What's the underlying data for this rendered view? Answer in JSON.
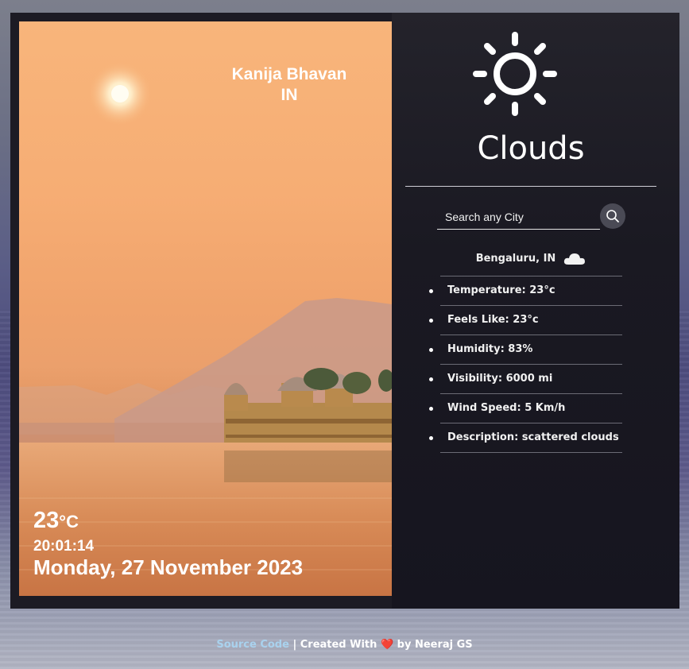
{
  "photo": {
    "location_name": "Kanija Bhavan",
    "country": "IN",
    "temperature": "23",
    "temperature_unit": "°C",
    "time": "20:01:14",
    "date": "Monday, 27 November 2023"
  },
  "weather": {
    "icon": "sun-icon",
    "condition": "Clouds"
  },
  "search": {
    "placeholder": "Search any City",
    "button_icon": "search-icon"
  },
  "current": {
    "city": "Bengaluru, IN",
    "icon": "cloud-icon",
    "details": [
      {
        "label": "Temperature: 23°c"
      },
      {
        "label": "Feels Like: 23°c"
      },
      {
        "label": "Humidity: 83%"
      },
      {
        "label": "Visibility: 6000 mi"
      },
      {
        "label": "Wind Speed: 5 Km/h"
      },
      {
        "label": "Description: scattered clouds"
      }
    ]
  },
  "footer": {
    "link": "Source Code",
    "separator": " | Created With ",
    "heart": "❤️",
    "by": " by Neeraj GS"
  },
  "colors": {
    "link": "#a9d2ee",
    "heart": "#e53935"
  }
}
